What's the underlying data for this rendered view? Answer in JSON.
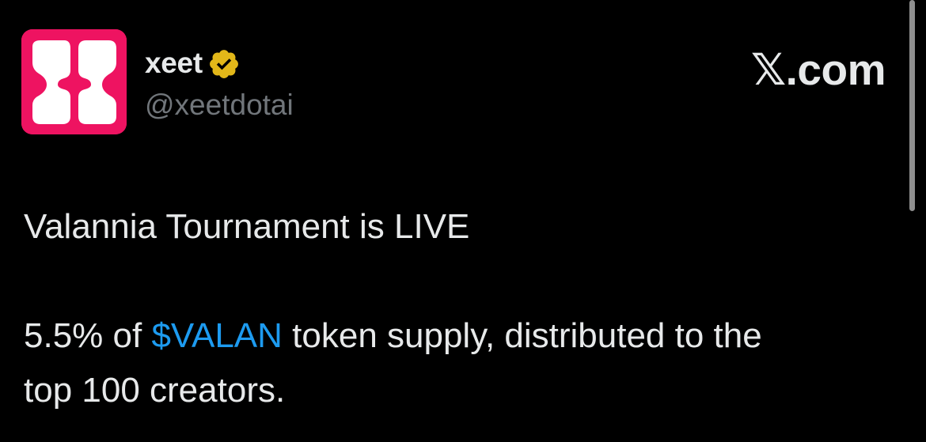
{
  "header": {
    "display_name": "xeet",
    "handle": "@xeetdotai",
    "brand_text": "𝕏.com",
    "verified_badge_icon": "verified-gold-badge",
    "avatar_icon": "xeet-logo"
  },
  "tweet": {
    "line1": "Valannia Tournament is LIVE",
    "line2_prefix": "5.5% of ",
    "cashtag": "$VALAN",
    "line2_suffix": " token supply, distributed to the",
    "line3": "top 100 creators."
  },
  "colors": {
    "background": "#000000",
    "text": "#e7e9ea",
    "muted": "#71767b",
    "link": "#1d9bf0",
    "avatar_bg": "#ee1361",
    "badge_gold": "#e2b719"
  }
}
